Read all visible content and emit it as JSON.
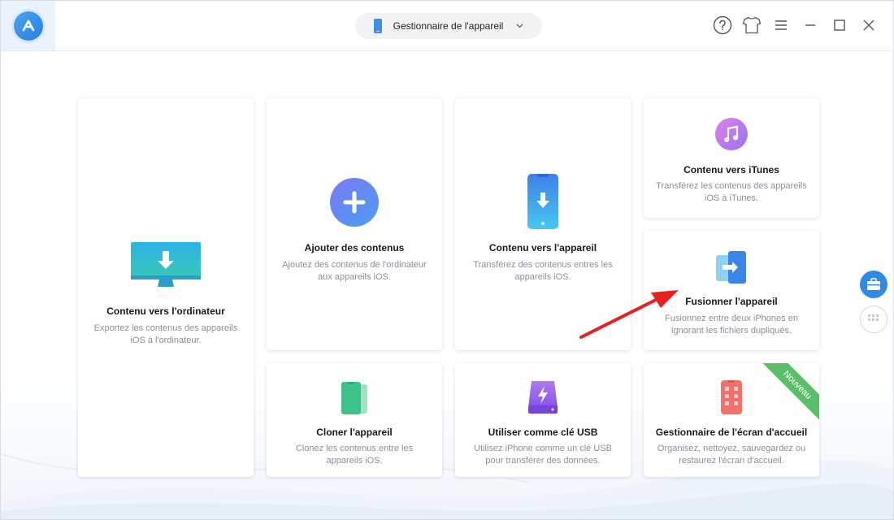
{
  "header": {
    "device_selector_label": "Gestionnaire de l'appareil"
  },
  "icons": {
    "logo": "app-logo-icon",
    "help": "help-icon",
    "skin": "tshirt-icon",
    "menu": "hamburger-menu-icon",
    "minimize": "minimize-icon",
    "maximize": "maximize-icon",
    "close": "close-icon"
  },
  "cards": {
    "to_computer": {
      "title": "Contenu vers l'ordinateur",
      "desc1": "Exportez les contenus des appareils",
      "desc2": "iOS à l'ordinateur."
    },
    "add_content": {
      "title": "Ajouter des contenus",
      "desc1": "Ajoutez des contenus de l'ordinateur",
      "desc2": "aux appareils iOS."
    },
    "to_device": {
      "title": "Contenu vers l'appareil",
      "desc1": "Transférez des contenus entres les",
      "desc2": "appareils iOS."
    },
    "to_itunes": {
      "title": "Contenu vers iTunes",
      "desc1": "Transférez les contenus des appareils",
      "desc2": "iOS à iTunes."
    },
    "merge": {
      "title": "Fusionner l'appareil",
      "desc1": "Fusionnez entre deux iPhones en",
      "desc2": "ignorant les fichiers dupliqués."
    },
    "clone": {
      "title": "Cloner l'appareil",
      "desc1": "Clonez les contenus entre les",
      "desc2": "appareils iOS."
    },
    "usb": {
      "title": "Utiliser comme clé USB",
      "desc1": "Utilisez iPhone comme un clé USB",
      "desc2": "pour transférer des données."
    },
    "home_screen": {
      "title": "Gestionnaire de l'écran d'accueil",
      "desc1": "Organisez, nettoyez, sauvegardez ou",
      "desc2": "restaurez l'écran d'accueil.",
      "badge": "Nouveau"
    }
  },
  "colors": {
    "accent": "#2f8ae8",
    "annotation_arrow": "#e8201e",
    "new_badge": "#5bbf6a"
  }
}
